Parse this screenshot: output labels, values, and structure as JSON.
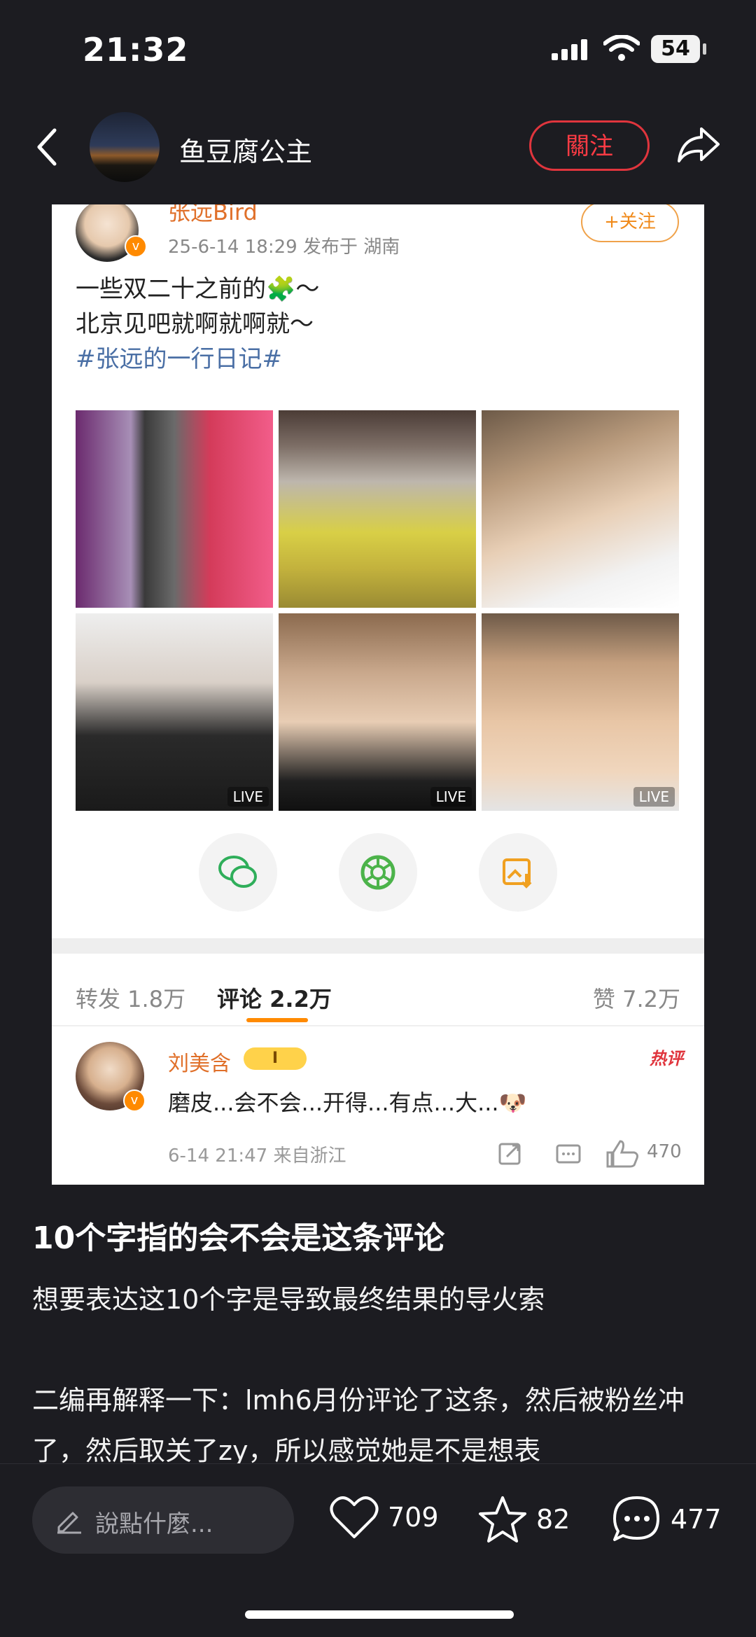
{
  "status_bar": {
    "time": "21:32",
    "battery": "54"
  },
  "header": {
    "user_name": "鱼豆腐公主",
    "follow_label": "關注"
  },
  "embedded_post": {
    "author": "张远Bird",
    "meta": "25-6-14 18:29  发布于 湖南",
    "follow_label": "+关注",
    "text_line1": "一些双二十之前的🧩～",
    "text_line2": "北京见吧就啊就啊就～",
    "hashtag": "#张远的一行日记#",
    "live_label": "LIVE",
    "tabs": {
      "repost": "转发 1.8万",
      "comment": "评论 2.2万",
      "like": "赞 7.2万"
    },
    "comment": {
      "author": "刘美含",
      "level": "I",
      "hot_tag": "热评",
      "text": "磨皮...会不会...开得...有点...大...🐶",
      "time": "6-14 21:47  来自浙江",
      "likes": "470"
    }
  },
  "article": {
    "headline": "10个字指的会不会是这条评论",
    "paragraph1": "想要表达这10个字是导致最终结果的导火索",
    "paragraph2": "二编再解释一下：lmh6月份评论了这条，然后被粉丝冲了，然后取关了zy，所以感觉她是不是想表"
  },
  "bottom_bar": {
    "comment_placeholder": "說點什麼...",
    "likes": "709",
    "favorites": "82",
    "comments": "477"
  }
}
